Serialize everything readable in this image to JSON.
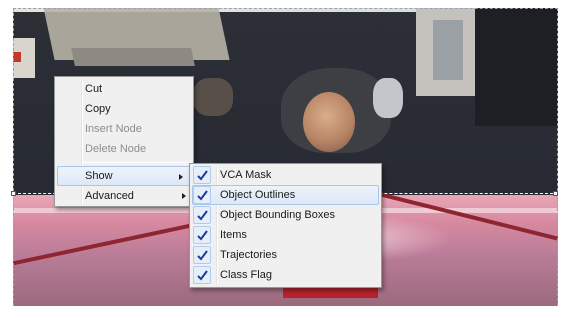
{
  "context_menu": {
    "items": [
      {
        "label": "Cut",
        "enabled": true
      },
      {
        "label": "Copy",
        "enabled": true
      },
      {
        "label": "Insert Node",
        "enabled": false
      },
      {
        "label": "Delete Node",
        "enabled": false
      }
    ],
    "submenus": [
      {
        "label": "Show",
        "open": true
      },
      {
        "label": "Advanced",
        "open": false
      }
    ]
  },
  "show_submenu": {
    "items": [
      {
        "label": "VCA Mask",
        "checked": true,
        "highlighted": false
      },
      {
        "label": "Object Outlines",
        "checked": true,
        "highlighted": true
      },
      {
        "label": "Object Bounding Boxes",
        "checked": true,
        "highlighted": false
      },
      {
        "label": "Items",
        "checked": true,
        "highlighted": false
      },
      {
        "label": "Trajectories",
        "checked": true,
        "highlighted": false
      },
      {
        "label": "Class Flag",
        "checked": true,
        "highlighted": false
      }
    ]
  },
  "colors": {
    "menu_background": "#f0f0f0",
    "highlight": "#dde8f8",
    "checkmark": "#1a3f99",
    "zone_handle": "#2a56c6"
  },
  "icons": {
    "submenu_arrow": "chevron-right-icon",
    "check": "checkmark-icon"
  }
}
